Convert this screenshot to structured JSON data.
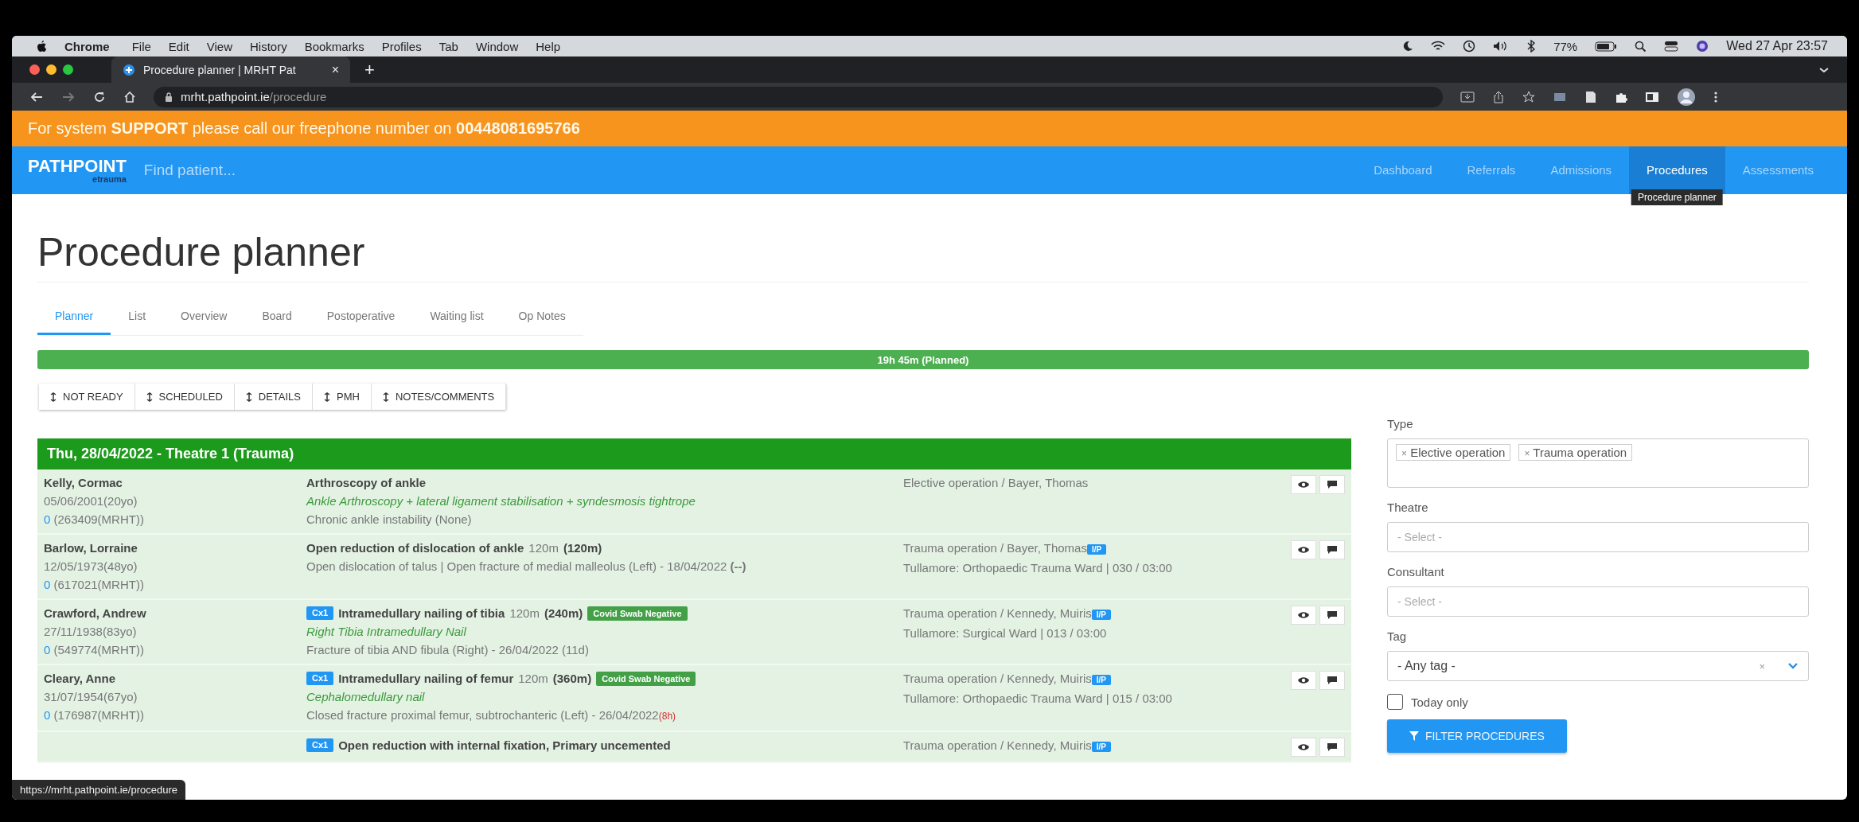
{
  "menubar": {
    "app": "Chrome",
    "menus": [
      "File",
      "Edit",
      "View",
      "History",
      "Bookmarks",
      "Profiles",
      "Tab",
      "Window",
      "Help"
    ],
    "battery": "77%",
    "clock": "Wed 27 Apr 23:57"
  },
  "browser": {
    "tab_title": "Procedure planner | MRHT Pat",
    "tab_close": "×",
    "new_tab": "+",
    "url_host": "mrht.pathpoint.ie",
    "url_path": "/procedure",
    "status_url": "https://mrht.pathpoint.ie/procedure"
  },
  "banner": "For system **SUPPORT** please call our freephone number on **00448081695766**",
  "navbar": {
    "logo": "PATHPOINT",
    "logo_sub": "etrauma",
    "search": {
      "placeholder": "Find patient..."
    },
    "items": [
      {
        "label": "Dashboard",
        "selected": false
      },
      {
        "label": "Referrals",
        "selected": false
      },
      {
        "label": "Admissions",
        "selected": false
      },
      {
        "label": "Procedures",
        "selected": true
      },
      {
        "label": "Assessments",
        "selected": false
      }
    ],
    "tooltip": "Procedure planner"
  },
  "page": {
    "title": "Procedure planner",
    "tabs": [
      {
        "label": "Planner",
        "selected": true
      },
      {
        "label": "List",
        "selected": false
      },
      {
        "label": "Overview",
        "selected": false
      },
      {
        "label": "Board",
        "selected": false
      },
      {
        "label": "Postoperative",
        "selected": false
      },
      {
        "label": "Waiting list",
        "selected": false
      },
      {
        "label": "Op Notes",
        "selected": false
      }
    ],
    "progress": {
      "label": "19h 45m (Planned)",
      "level": 1
    },
    "sort_buttons": [
      "NOT READY",
      "SCHEDULED",
      "DETAILS",
      "PMH",
      "NOTES/COMMENTS"
    ]
  },
  "schedule": {
    "header": "Thu, 28/04/2022 - Theatre 1 (Trauma)",
    "rows": [
      {
        "patient": {
          "name": "Kelly, Cormac",
          "dob": "05/06/2001(20yo)",
          "link": "0",
          "mrn": "(263409(MRHT))"
        },
        "procedure": {
          "title": "Arthroscopy of ankle",
          "detail": "Ankle Arthroscopy + lateral ligament stabilisation + syndesmosis tightrope",
          "diagnosis": "Chronic ankle instability (None)"
        },
        "booking": {
          "type": "Elective operation / Bayer, Thomas"
        }
      },
      {
        "patient": {
          "name": "Barlow, Lorraine",
          "dob": "12/05/1973(48yo)",
          "link": "0",
          "mrn": "(617021(MRHT))"
        },
        "procedure": {
          "title": "Open reduction of dislocation of ankle",
          "duration": "120m",
          "total": "(120m)",
          "diagnosis": "Open dislocation of talus | Open fracture of medial malleolus (Left) - 18/04/2022 **(--)**"
        },
        "booking": {
          "type": "Trauma operation / Bayer, Thomas",
          "badge": "I/P",
          "ward": "Tullamore: Orthopaedic Trauma Ward | 030 / 03:00"
        }
      },
      {
        "patient": {
          "name": "Crawford, Andrew",
          "dob": "27/11/1938(83yo)",
          "link": "0",
          "mrn": "(549774(MRHT))"
        },
        "procedure": {
          "badge": "Cx1",
          "title": "Intramedullary nailing of tibia",
          "duration": "120m",
          "total": "(240m)",
          "tag": "Covid Swab Negative",
          "detail": "Right Tibia Intramedullary Nail",
          "diagnosis": "Fracture of tibia AND fibula (Right) - 26/04/2022 (11d)"
        },
        "booking": {
          "type": "Trauma operation / Kennedy, Muiris",
          "badge": "I/P",
          "ward": "Tullamore: Surgical Ward | 013 / 03:00"
        }
      },
      {
        "patient": {
          "name": "Cleary, Anne",
          "dob": "31/07/1954(67yo)",
          "link": "0",
          "mrn": "(176987(MRHT))"
        },
        "procedure": {
          "badge": "Cx1",
          "title": "Intramedullary nailing of femur",
          "duration": "120m",
          "total": "(360m)",
          "tag": "Covid Swab Negative",
          "detail": "Cephalomedullary nail",
          "diagnosis": "Closed fracture proximal femur, subtrochanteric (Left) - 26/04/2022",
          "alert": "(8h)"
        },
        "booking": {
          "type": "Trauma operation / Kennedy, Muiris",
          "badge": "I/P",
          "ward": "Tullamore: Orthopaedic Trauma Ward | 015 / 03:00"
        }
      },
      {
        "procedure": {
          "badge": "Cx1",
          "title": "Open reduction with internal fixation, Primary uncemented"
        },
        "booking": {
          "type": "Trauma operation / Kennedy, Muiris",
          "badge": "I/P"
        }
      }
    ]
  },
  "filters": {
    "type": {
      "label": "Type",
      "tags": [
        {
          "remove": "×",
          "label": "Elective operation"
        },
        {
          "remove": "×",
          "label": "Trauma operation"
        }
      ]
    },
    "theatre": {
      "label": "Theatre",
      "placeholder": "- Select -"
    },
    "consultant": {
      "label": "Consultant",
      "placeholder": "- Select -"
    },
    "tag": {
      "label": "Tag",
      "value": "- Any tag -",
      "clear": "×"
    },
    "today_only": {
      "label": "Today only",
      "checked": false
    },
    "button": "FILTER PROCEDURES"
  }
}
